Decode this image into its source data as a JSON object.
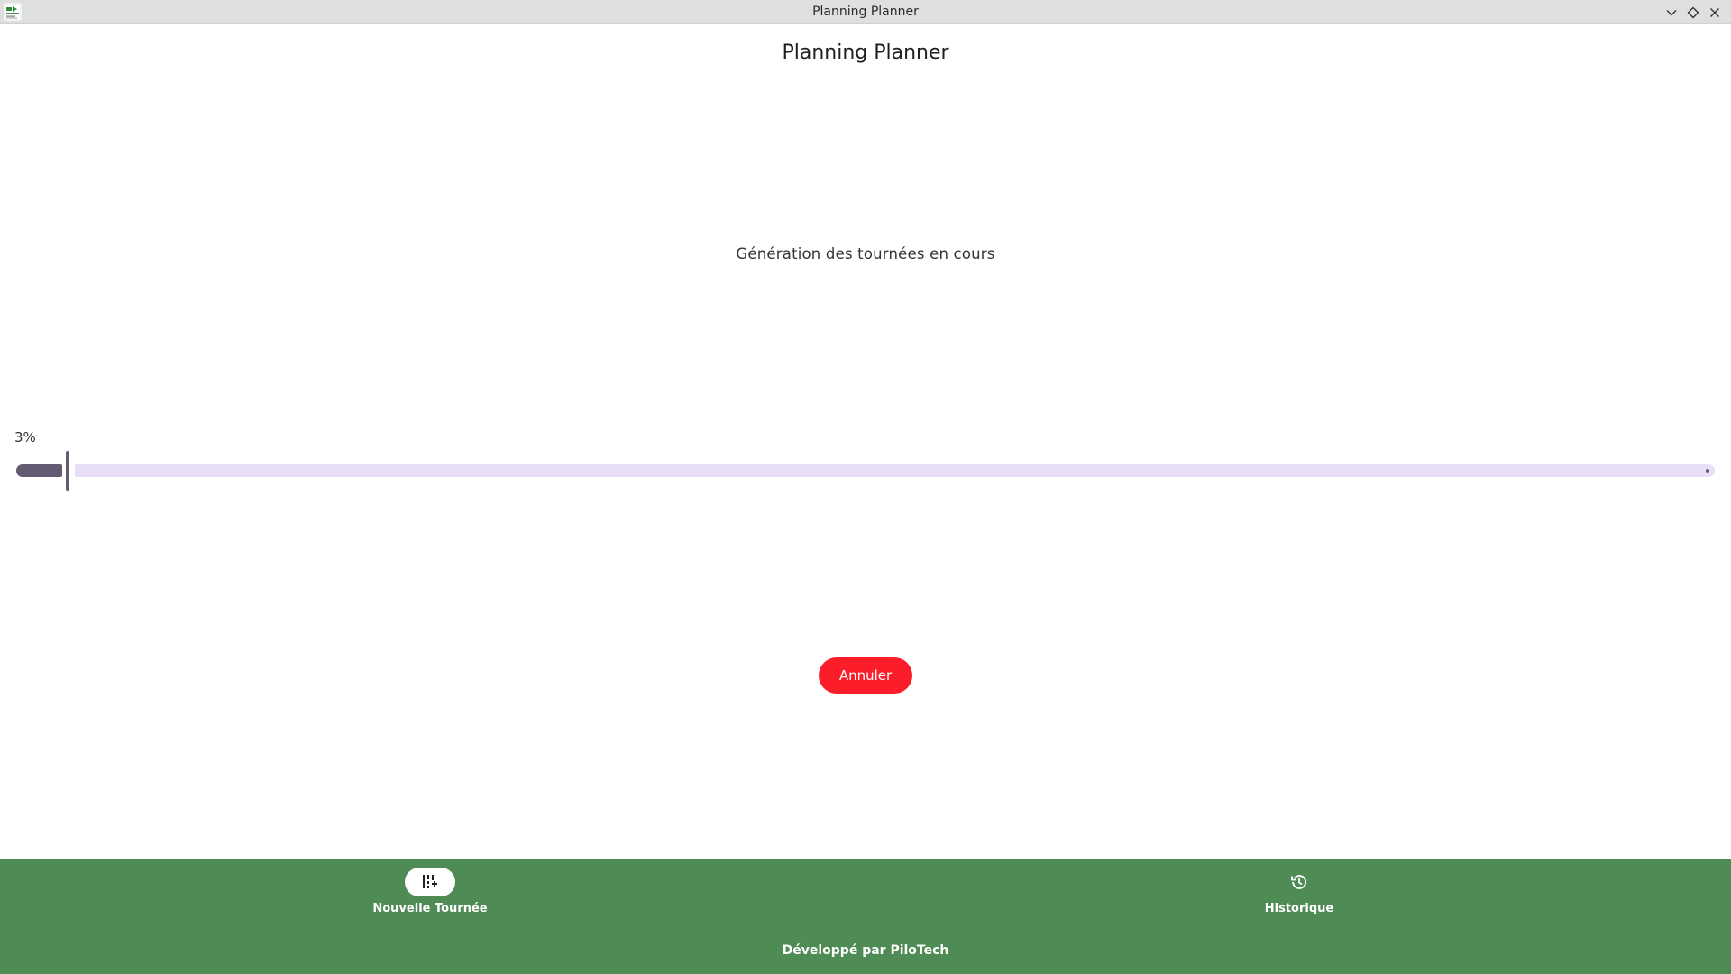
{
  "window": {
    "title": "Planning Planner",
    "icons": {
      "minimize": "chevron-down-icon",
      "maximize": "diamond-icon",
      "close": "close-icon"
    }
  },
  "main": {
    "title": "Planning Planner",
    "status": "Génération des tournées en cours",
    "progress": {
      "value_percent": 3,
      "label": "3%"
    },
    "cancel_label": "Annuler"
  },
  "bottom_nav": {
    "items": [
      {
        "label": "Nouvelle Tournée",
        "icon": "add-route-icon",
        "active": true
      },
      {
        "label": "Historique",
        "icon": "history-icon",
        "active": false
      }
    ],
    "footer": "Développé par PiloTech"
  },
  "colors": {
    "nav_background": "#4f8b55",
    "cancel_button": "#fb1d2a",
    "progress_fill": "#625b71",
    "progress_track": "#e8def8"
  }
}
